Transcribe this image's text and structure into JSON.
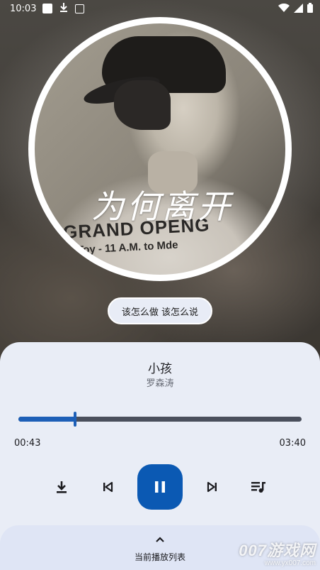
{
  "status_bar": {
    "time": "10:03",
    "icons": [
      "stop-square-icon",
      "download-icon",
      "app-icon",
      "wifi-icon",
      "signal-icon",
      "battery-icon"
    ]
  },
  "cover": {
    "calligraphy": "为何离开",
    "shirt_line1": "GRAND OPENG",
    "shirt_line2": "Toy - 11 A.M. to Mde"
  },
  "lyric": "该怎么做 该怎么说",
  "song": {
    "title": "小孩",
    "artist": "罗森涛"
  },
  "progress": {
    "current": "00:43",
    "total": "03:40",
    "fraction": 0.2
  },
  "controls": [
    "download-icon",
    "skip-previous-icon",
    "pause-icon",
    "skip-next-icon",
    "queue-music-icon"
  ],
  "playlist": {
    "label": "当前播放列表"
  },
  "watermark": {
    "brand": "007游戏网",
    "url": "www.yx007.com"
  },
  "colors": {
    "accent": "#0b59b3",
    "panel": "#e9edf6",
    "track": "#4a4f5c"
  }
}
